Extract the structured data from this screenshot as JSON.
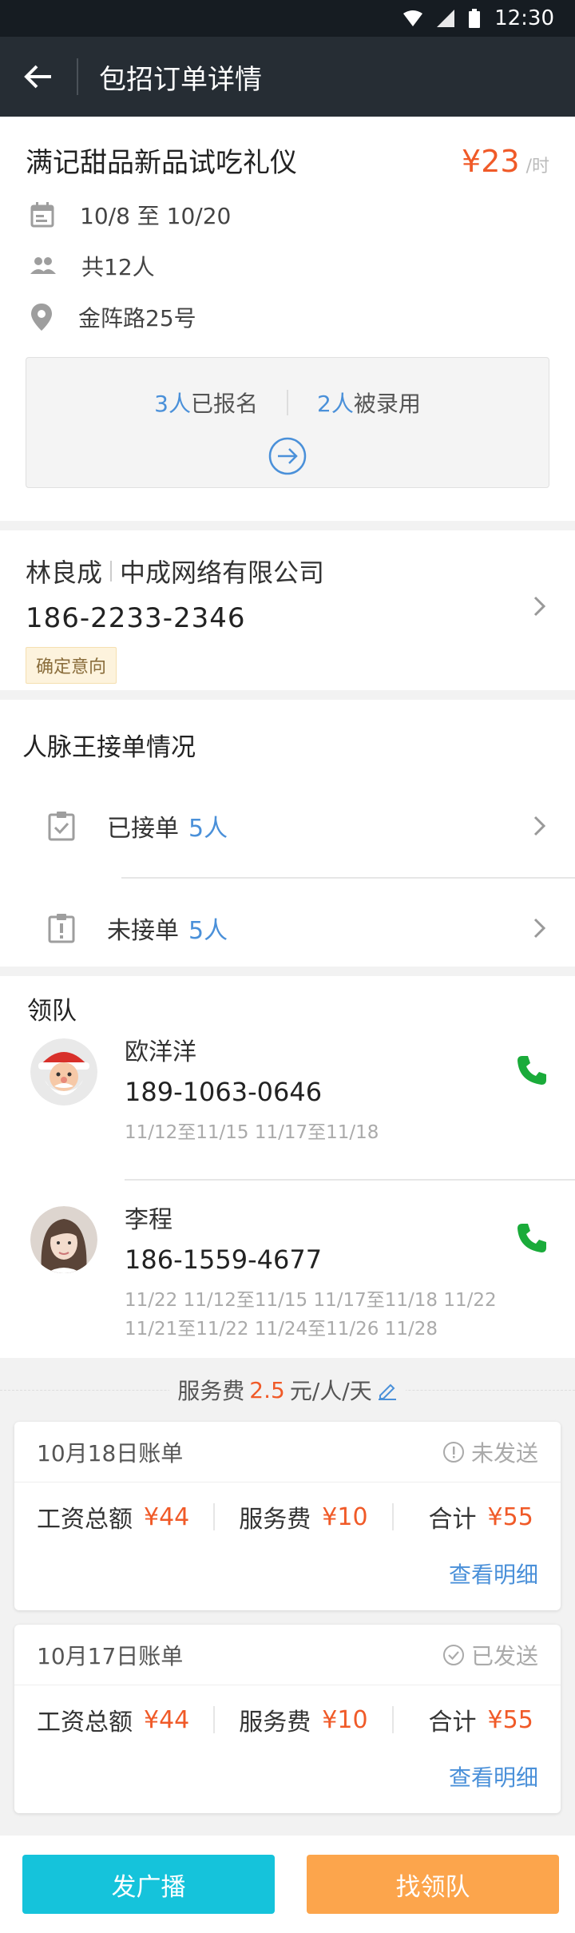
{
  "status_bar": {
    "time": "12:30"
  },
  "app_bar": {
    "title": "包招订单详情"
  },
  "order": {
    "title": "满记甜品新品试吃礼仪",
    "price": "¥23",
    "price_unit": "/时",
    "date_range": "10/8 至 10/20",
    "headcount": "共12人",
    "address": "金阵路25号",
    "signup": {
      "signed_num": "3人",
      "signed_label": "已报名",
      "hired_num": "2人",
      "hired_label": "被录用"
    }
  },
  "contact": {
    "name": "林良成",
    "company": "中成网络有限公司",
    "phone": "186-2233-2346",
    "tag": "确定意向"
  },
  "receive": {
    "title": "人脉王接单情况",
    "items": [
      {
        "label": "已接单",
        "count": "5人"
      },
      {
        "label": "未接单",
        "count": "5人"
      }
    ]
  },
  "leaders": {
    "title": "领队",
    "list": [
      {
        "name": "欧洋洋",
        "phone": "189-1063-0646",
        "dates_line1": "11/12至11/15   11/17至11/18",
        "dates_line2": ""
      },
      {
        "name": "李程",
        "phone": "186-1559-4677",
        "dates_line1": "11/22   11/12至11/15   11/17至11/18   11/22",
        "dates_line2": "11/21至11/22   11/24至11/26   11/28"
      }
    ]
  },
  "fee": {
    "prefix": "服务费",
    "value": "2.5",
    "suffix": "元/人/天"
  },
  "bills": [
    {
      "date": "10月18日账单",
      "status": "未发送",
      "wage_label": "工资总额",
      "wage": "¥44",
      "fee_label": "服务费",
      "fee": "¥10",
      "total_label": "合计",
      "total": "¥55",
      "detail": "查看明细"
    },
    {
      "date": "10月17日账单",
      "status": "已发送",
      "wage_label": "工资总额",
      "wage": "¥44",
      "fee_label": "服务费",
      "fee": "¥10",
      "total_label": "合计",
      "total": "¥55",
      "detail": "查看明细"
    }
  ],
  "actions": {
    "broadcast": "发广播",
    "find_leader": "找领队"
  },
  "colors": {
    "accent_orange": "#f05a28",
    "link_blue": "#4a90d9",
    "call_green": "#1aab3a",
    "button_blue": "#15c3db",
    "button_orange": "#fca54c"
  }
}
